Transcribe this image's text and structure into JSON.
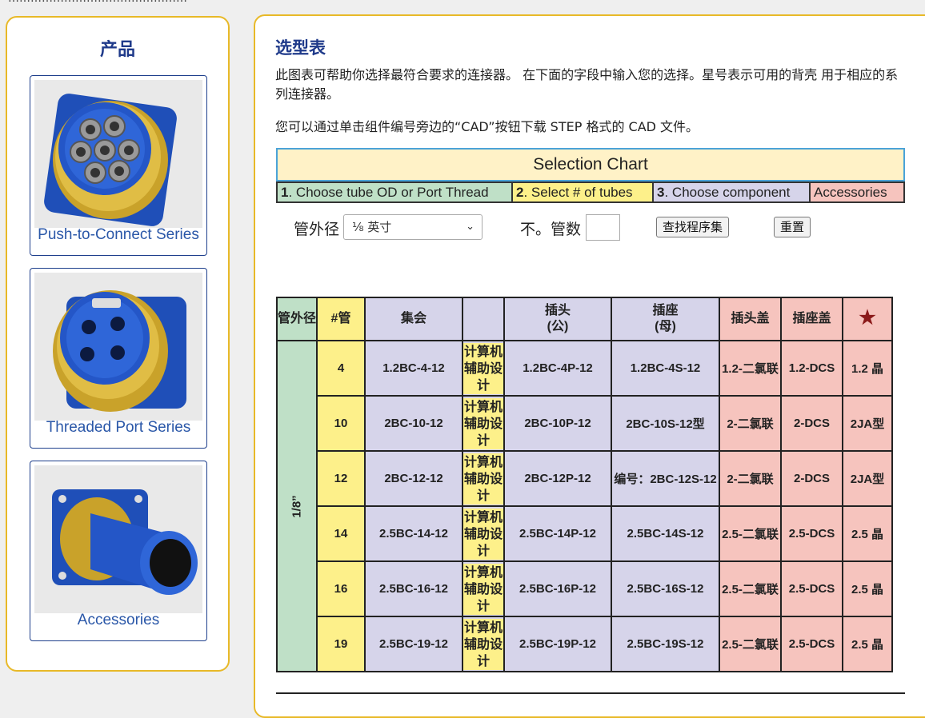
{
  "top_strip_text": "…………………………………………",
  "sidebar": {
    "title": "产品",
    "cards": [
      {
        "caption": "Push-to-Connect Series"
      },
      {
        "caption": "Threaded Port Series"
      },
      {
        "caption": "Accessories"
      }
    ]
  },
  "main": {
    "title": "选型表",
    "intro": "此图表可帮助你选择最符合要求的连接器。 在下面的字段中输入您的选择。星号表示可用的背壳 用于相应的系列连接器。",
    "cad_note": "您可以通过单击组件编号旁边的“CAD”按钮下载 STEP 格式的 CAD 文件。"
  },
  "selection_chart": {
    "title": "Selection Chart",
    "steps": [
      {
        "num": "1",
        "label": ". Choose tube OD or Port Thread",
        "color": "#bfe0c7"
      },
      {
        "num": "2",
        "label": ".  Select # of tubes",
        "color": "#fdf08a"
      },
      {
        "num": "3",
        "label": ". Choose component",
        "color": "#d6d4ea"
      },
      {
        "num": "",
        "label": "Accessories",
        "color": "#f6c4be"
      }
    ]
  },
  "filters": {
    "od_label": "管外径",
    "od_value": "⅛ 英寸",
    "count_label": "不。管数",
    "find_button": "查找程序集",
    "reset_button": "重置"
  },
  "table": {
    "headers": {
      "od": "管外径",
      "count": "#管",
      "assembly": "集会",
      "cad": "",
      "plug": "插头\n(公)",
      "receptacle": "插座\n(母)",
      "plug_cap": "插头盖",
      "receptacle_cap": "插座盖",
      "star": "★"
    },
    "od_value": "1/8”",
    "cad_label": "计算机辅助设计",
    "rows": [
      {
        "count": "4",
        "assembly": "1.2BC-4-12",
        "plug": "1.2BC-4P-12",
        "receptacle": "1.2BC-4S-12",
        "plug_cap": "1.2-二氯联",
        "receptacle_cap": "1.2-DCS",
        "backshell": "1.2 晶"
      },
      {
        "count": "10",
        "assembly": "2BC-10-12",
        "plug": "2BC-10P-12",
        "receptacle": "2BC-10S-12型",
        "plug_cap": "2-二氯联",
        "receptacle_cap": "2-DCS",
        "backshell": "2JA型"
      },
      {
        "count": "12",
        "assembly": "2BC-12-12",
        "plug": "2BC-12P-12",
        "receptacle": "编号：2BC-12S-12",
        "plug_cap": "2-二氯联",
        "receptacle_cap": "2-DCS",
        "backshell": "2JA型"
      },
      {
        "count": "14",
        "assembly": "2.5BC-14-12",
        "plug": "2.5BC-14P-12",
        "receptacle": "2.5BC-14S-12",
        "plug_cap": "2.5-二氯联",
        "receptacle_cap": "2.5-DCS",
        "backshell": "2.5 晶"
      },
      {
        "count": "16",
        "assembly": "2.5BC-16-12",
        "plug": "2.5BC-16P-12",
        "receptacle": "2.5BC-16S-12",
        "plug_cap": "2.5-二氯联",
        "receptacle_cap": "2.5-DCS",
        "backshell": "2.5 晶"
      },
      {
        "count": "19",
        "assembly": "2.5BC-19-12",
        "plug": "2.5BC-19P-12",
        "receptacle": "2.5BC-19S-12",
        "plug_cap": "2.5-二氯联",
        "receptacle_cap": "2.5-DCS",
        "backshell": "2.5 晶"
      }
    ]
  },
  "colors": {
    "border_gold": "#e8b928",
    "title_blue": "#1f3a8a",
    "caption_blue": "#2a57a8",
    "od_green": "#bfe0c7",
    "count_yellow": "#fdf08a",
    "component_lavender": "#d6d4ea",
    "accessory_pink": "#f6c4be",
    "star_red": "#8b1a1a"
  }
}
